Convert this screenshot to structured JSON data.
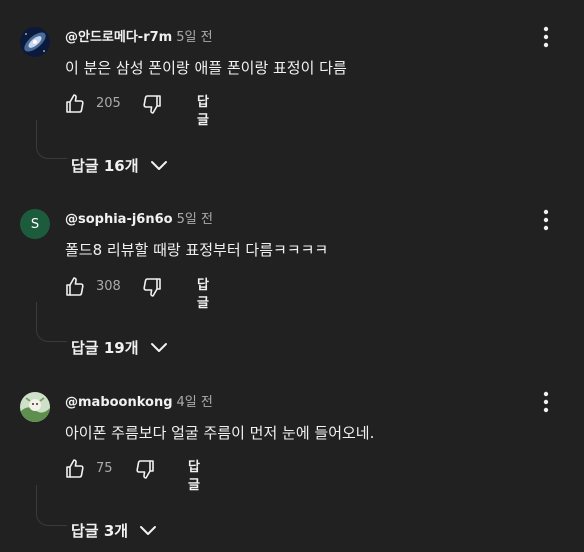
{
  "comments": [
    {
      "author": "@안드로메다-r7m",
      "time": "5일 전",
      "text": "이 분은 삼성 폰이랑 애플 폰이랑 표정이 다름",
      "likes": "205",
      "reply_label": "답글",
      "replies_label": "답글 16개",
      "avatar": {
        "type": "image",
        "colors": [
          "#0b1a3a",
          "#5a7fb0",
          "#c9d8ef"
        ]
      }
    },
    {
      "author": "@sophia-j6n6o",
      "time": "5일 전",
      "text": "폴드8 리뷰할 때랑 표정부터 다름ㅋㅋㅋㅋ",
      "likes": "308",
      "reply_label": "답글",
      "replies_label": "답글 19개",
      "avatar": {
        "type": "letter",
        "letter": "S",
        "bg": "#1c5c3c"
      }
    },
    {
      "author": "@maboonkong",
      "time": "4일 전",
      "text": "아이폰 주름보다 얼굴 주름이 먼저 눈에 들어오네.",
      "likes": "75",
      "reply_label": "답글",
      "replies_label": "답글 3개",
      "avatar": {
        "type": "image",
        "colors": [
          "#cfe0c8",
          "#5f8f4f",
          "#f4f0ea"
        ]
      }
    }
  ],
  "icons": {
    "like": "thumb-up-icon",
    "dislike": "thumb-down-icon",
    "more": "more-vert-icon",
    "expand": "chevron-down-icon"
  },
  "colors": {
    "background": "#212121",
    "text": "#f1f1f1",
    "secondary": "#aaaaaa"
  }
}
